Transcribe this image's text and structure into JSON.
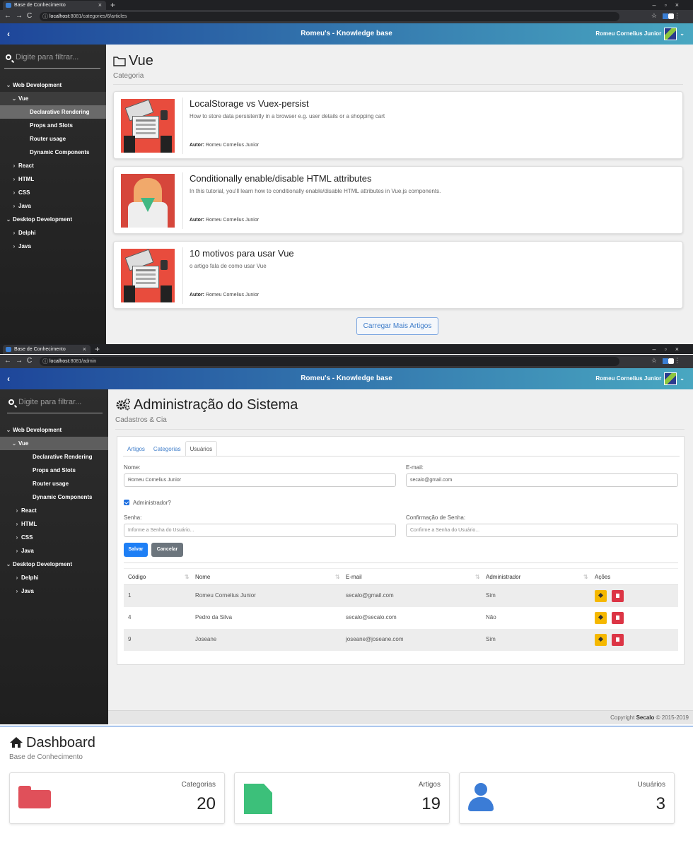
{
  "screen1": {
    "browser": {
      "tab_title": "Base de Conhecimento",
      "url_host": "localhost",
      "url_path": ":8081/categories/6/articles"
    },
    "header": {
      "toggle": "‹",
      "title": "Romeu's - Knowledge base",
      "user": "Romeu Cornelius Junior"
    },
    "sidebar": {
      "search_placeholder": "Digite para filtrar...",
      "items": [
        {
          "label": "Web Development"
        },
        {
          "label": "Vue"
        },
        {
          "label": "Declarative Rendering"
        },
        {
          "label": "Props and Slots"
        },
        {
          "label": "Router usage"
        },
        {
          "label": "Dynamic Components"
        },
        {
          "label": "React"
        },
        {
          "label": "HTML"
        },
        {
          "label": "CSS"
        },
        {
          "label": "Java"
        },
        {
          "label": "Desktop Development"
        },
        {
          "label": "Delphi"
        },
        {
          "label": "Java"
        }
      ]
    },
    "page": {
      "title": "Vue",
      "subtitle": "Categoria"
    },
    "articles": [
      {
        "title": "LocalStorage vs Vuex-persist",
        "description": "How to store data persistently in a browser e.g. user details or a shopping cart",
        "author_label": "Autor:",
        "author": "Romeu Cornelius Junior"
      },
      {
        "title": "Conditionally enable/disable HTML attributes",
        "description": "In this tutorial, you'll learn how to conditionally enable/disable HTML attributes in Vue.js components.",
        "author_label": "Autor:",
        "author": "Romeu Cornelius Junior"
      },
      {
        "title": "10 motivos para usar Vue",
        "description": "o artigo fala de como usar Vue",
        "author_label": "Autor:",
        "author": "Romeu Cornelius Junior"
      }
    ],
    "load_more": "Carregar Mais Artigos"
  },
  "screen2": {
    "browser": {
      "tab_title": "Base de Conhecimento",
      "url_host": "localhost",
      "url_path": ":8081/admin"
    },
    "header": {
      "toggle": "‹",
      "title": "Romeu's - Knowledge base",
      "user": "Romeu Cornelius Junior"
    },
    "sidebar": {
      "search_placeholder": "Digite para filtrar...",
      "items": [
        {
          "label": "Web Development"
        },
        {
          "label": "Vue"
        },
        {
          "label": "Declarative Rendering"
        },
        {
          "label": "Props and Slots"
        },
        {
          "label": "Router usage"
        },
        {
          "label": "Dynamic Components"
        },
        {
          "label": "React"
        },
        {
          "label": "HTML"
        },
        {
          "label": "CSS"
        },
        {
          "label": "Java"
        },
        {
          "label": "Desktop Development"
        },
        {
          "label": "Delphi"
        },
        {
          "label": "Java"
        }
      ]
    },
    "page": {
      "title": "Administração do Sistema",
      "subtitle": "Cadastros & Cia"
    },
    "tabs": [
      "Artigos",
      "Categorias",
      "Usuários"
    ],
    "form": {
      "name_label": "Nome:",
      "name_value": "Romeu Cornelius Junior",
      "email_label": "E-mail:",
      "email_value": "secalo@gmail.com",
      "admin_label": "Administrador?",
      "password_label": "Senha:",
      "password_placeholder": "Informe a Senha do Usuário...",
      "confirm_label": "Confirmação de Senha:",
      "confirm_placeholder": "Confirme a Senha do Usuário...",
      "save": "Salvar",
      "cancel": "Cancelar"
    },
    "table": {
      "headers": [
        "Código",
        "Nome",
        "E-mail",
        "Administrador",
        "Ações"
      ],
      "rows": [
        {
          "code": "1",
          "name": "Romeu Cornelius Junior",
          "email": "secalo@gmail.com",
          "admin": "Sim"
        },
        {
          "code": "4",
          "name": "Pedro da Silva",
          "email": "secalo@secalo.com",
          "admin": "Não"
        },
        {
          "code": "9",
          "name": "Joseane",
          "email": "joseane@joseane.com",
          "admin": "Sim"
        }
      ]
    },
    "footer": {
      "prefix": "Copyright",
      "brand": "Secalo",
      "suffix": "© 2015-2019"
    }
  },
  "dashboard": {
    "title": "Dashboard",
    "subtitle": "Base de Conhecimento",
    "stats": [
      {
        "label": "Categorias",
        "value": "20",
        "icon": "folder-icon",
        "color": "#e0505a"
      },
      {
        "label": "Artigos",
        "value": "19",
        "icon": "file-icon",
        "color": "#3cc07a"
      },
      {
        "label": "Usuários",
        "value": "3",
        "icon": "user-icon",
        "color": "#3b7cd6"
      }
    ]
  },
  "colors": {
    "header_start": "#1e469a",
    "header_end": "#49a7c1",
    "primary": "#1e7ff5",
    "danger": "#dc3545",
    "warning": "#f5b800"
  }
}
